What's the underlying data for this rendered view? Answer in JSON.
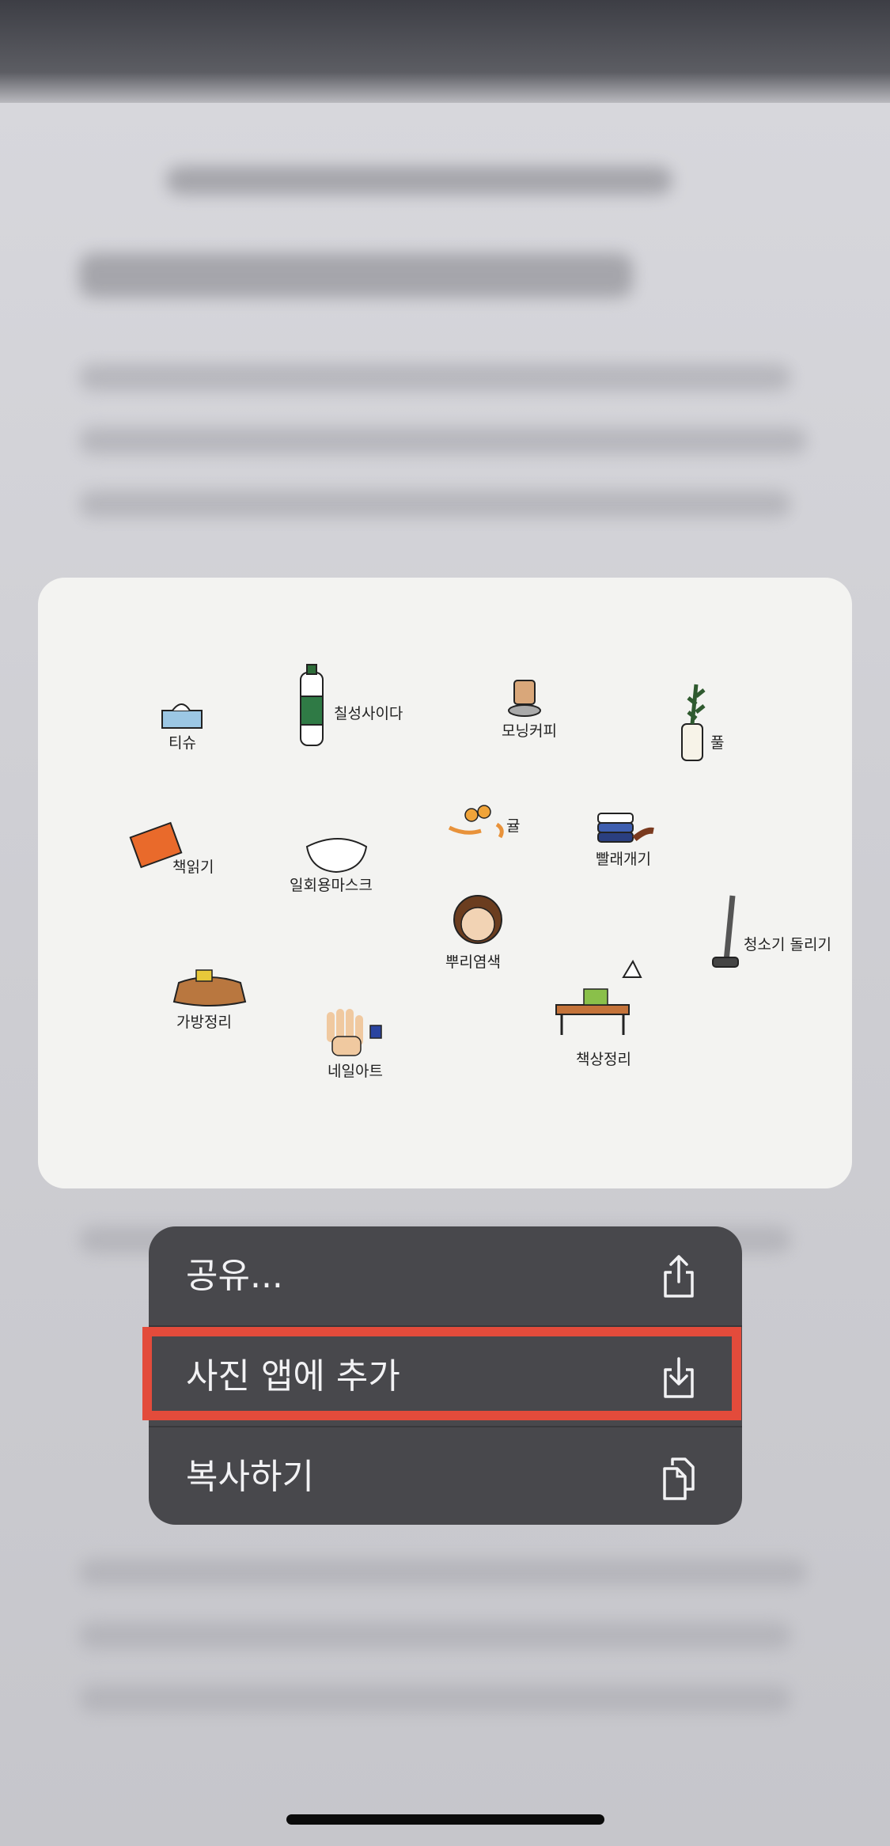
{
  "menu": {
    "items": [
      {
        "label": "공유...",
        "icon": "share-icon"
      },
      {
        "label": "사진 앱에 추가",
        "icon": "save-to-photos-icon"
      },
      {
        "label": "복사하기",
        "icon": "copy-icon"
      }
    ],
    "highlighted_index": 1
  },
  "preview_image": {
    "labels": {
      "tissue": "티슈",
      "soda": "칠성사이다",
      "coffee": "모닝커피",
      "plant": "풀",
      "reading": "책읽기",
      "mask": "일회용마스크",
      "tangerine": "귤",
      "laundry": "빨래개기",
      "hair_dye": "뿌리염색",
      "vacuum": "청소기 돌리기",
      "bag": "가방정리",
      "nail": "네일아트",
      "desk": "책상정리"
    }
  },
  "colors": {
    "menu_background": "#48484c",
    "highlight_border": "#e34b3b",
    "card_background": "#f3f3f1"
  }
}
